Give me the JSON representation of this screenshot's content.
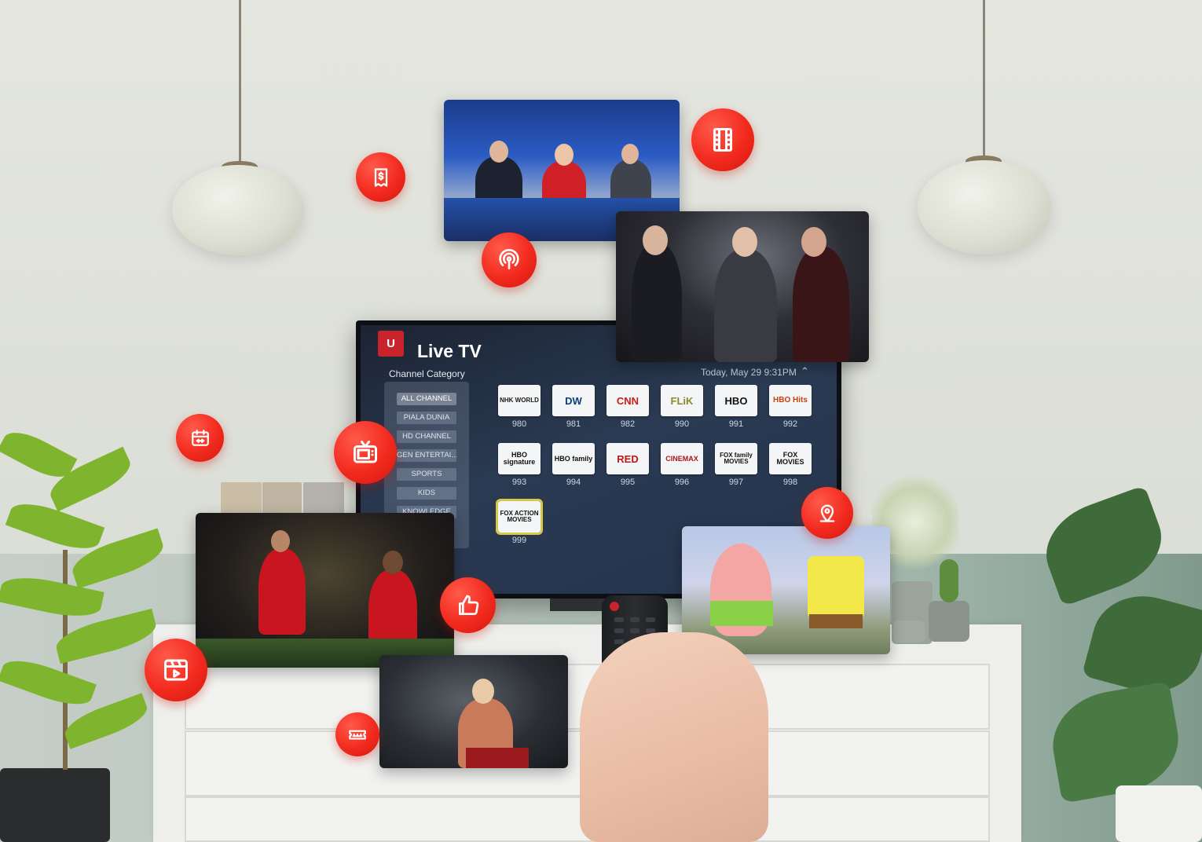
{
  "tv": {
    "logo_text": "U",
    "title": "Live TV",
    "category_heading": "Channel Category",
    "datetime": "Today, May 29 9:31PM",
    "categories": [
      {
        "label": "ALL CHANNEL",
        "active": true
      },
      {
        "label": "PIALA DUNIA",
        "active": false
      },
      {
        "label": "HD CHANNEL",
        "active": false
      },
      {
        "label": "GEN ENTERTAI...",
        "active": false
      },
      {
        "label": "SPORTS",
        "active": false
      },
      {
        "label": "KIDS",
        "active": false
      },
      {
        "label": "KNOWLEDGE",
        "active": false
      }
    ],
    "channels": [
      {
        "logo": "NHK WORLD",
        "number": "980",
        "color": "#1a1a1a"
      },
      {
        "logo": "DW",
        "number": "981",
        "color": "#0a3f7a"
      },
      {
        "logo": "CNN",
        "number": "982",
        "color": "#cc1b1b"
      },
      {
        "logo": "FLiK",
        "number": "990",
        "color": "#8a8a2a"
      },
      {
        "logo": "HBO",
        "number": "991",
        "color": "#111111"
      },
      {
        "logo": "HBO Hits",
        "number": "992",
        "color": "#c8420f"
      },
      {
        "logo": "HBO signature",
        "number": "993",
        "color": "#111111"
      },
      {
        "logo": "HBO family",
        "number": "994",
        "color": "#111111"
      },
      {
        "logo": "RED",
        "number": "995",
        "color": "#c01616"
      },
      {
        "logo": "CINEMAX",
        "number": "996",
        "color": "#b0121a"
      },
      {
        "logo": "FOX family MOVIES",
        "number": "997",
        "color": "#111111"
      },
      {
        "logo": "FOX MOVIES",
        "number": "998",
        "color": "#111111"
      },
      {
        "logo": "FOX ACTION MOVIES",
        "number": "999",
        "color": "#111111"
      }
    ]
  },
  "badges": [
    {
      "icon": "receipt-dollar-icon"
    },
    {
      "icon": "film-strip-icon"
    },
    {
      "icon": "broadcast-icon"
    },
    {
      "icon": "calendar-icon"
    },
    {
      "icon": "tv-icon"
    },
    {
      "icon": "location-pin-icon"
    },
    {
      "icon": "thumbs-up-icon"
    },
    {
      "icon": "video-clip-icon"
    },
    {
      "icon": "ticket-icon"
    }
  ],
  "thumbnails": [
    {
      "name": "news-thumbnail"
    },
    {
      "name": "music-performance-thumbnail"
    },
    {
      "name": "soccer-thumbnail"
    },
    {
      "name": "concert-singer-thumbnail"
    },
    {
      "name": "cartoon-thumbnail"
    }
  ],
  "colors": {
    "accent_red": "#f22a1e",
    "tv_background": "#24344d",
    "selection_outline": "#d8c84a"
  }
}
